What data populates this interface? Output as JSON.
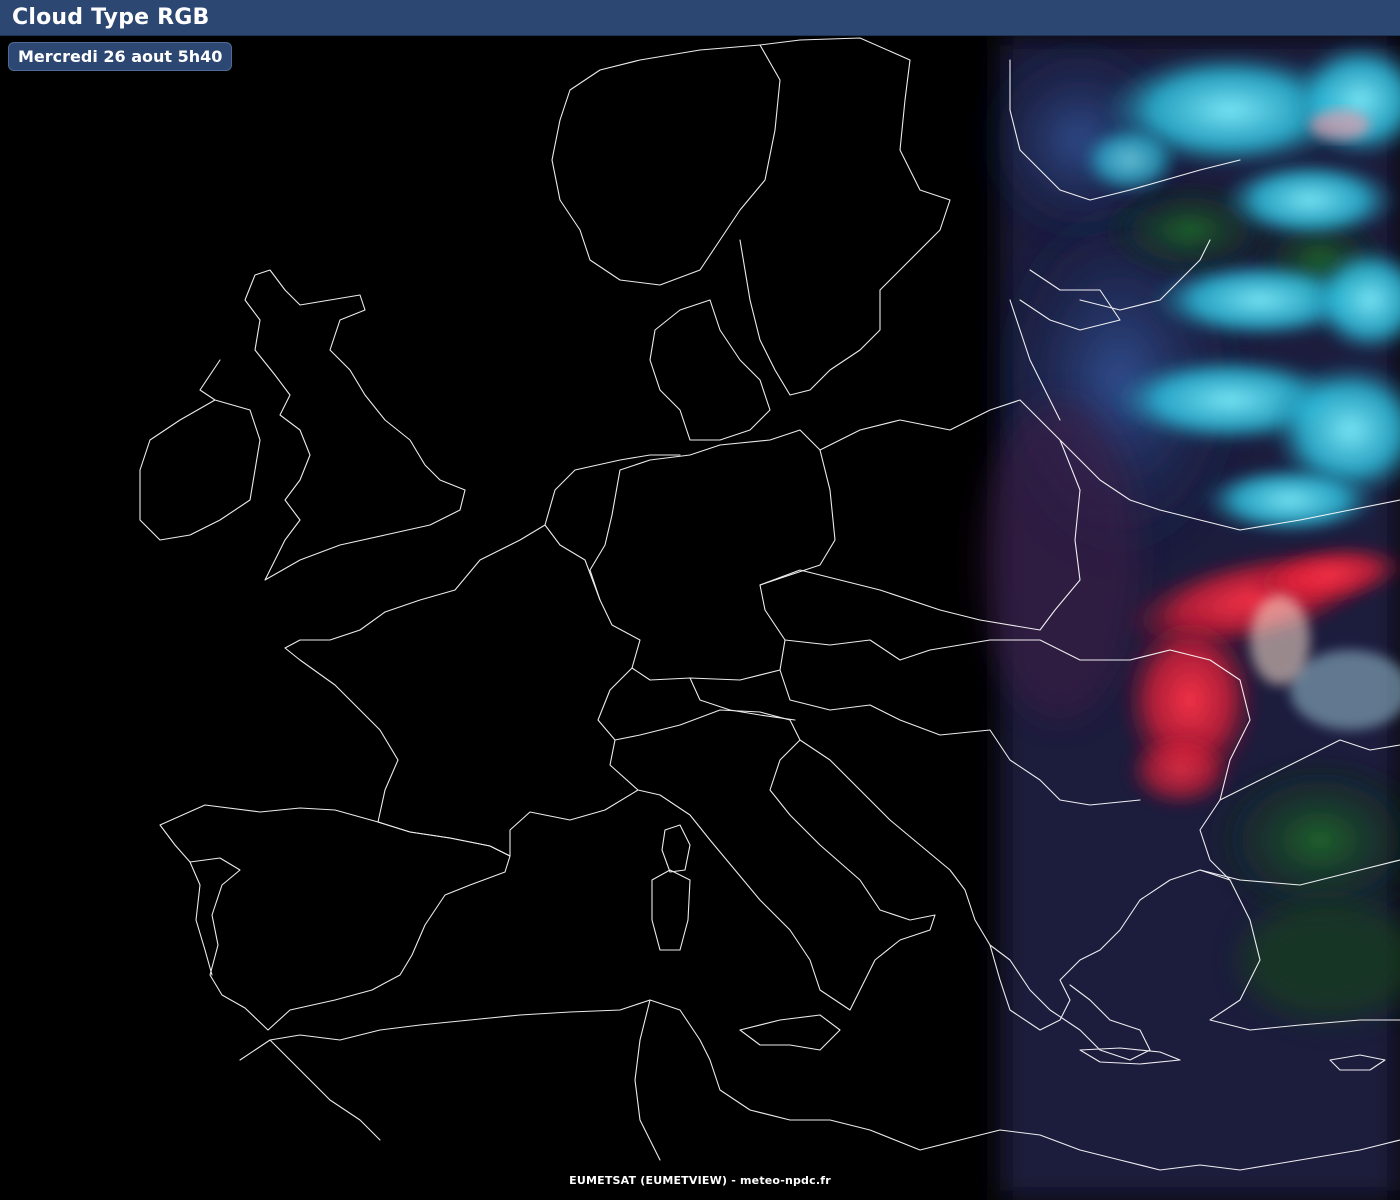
{
  "header": {
    "title": "Cloud Type RGB"
  },
  "timestamp": {
    "label": "Mercredi 26 aout 5h40"
  },
  "footer": {
    "credit": "EUMETSAT (EUMETVIEW) - meteo-npdc.fr"
  },
  "map": {
    "product": "Cloud Type RGB",
    "region": "Europe",
    "background_color": "#000000",
    "outline_color": "#ffffff",
    "cloud_colors": {
      "high_ice_cloud": "#ff2a40",
      "low_water_cloud": "#33ddff",
      "mid_level_cloud": "#2a5fa8",
      "land_vegetation": "#1f6a2a"
    }
  }
}
